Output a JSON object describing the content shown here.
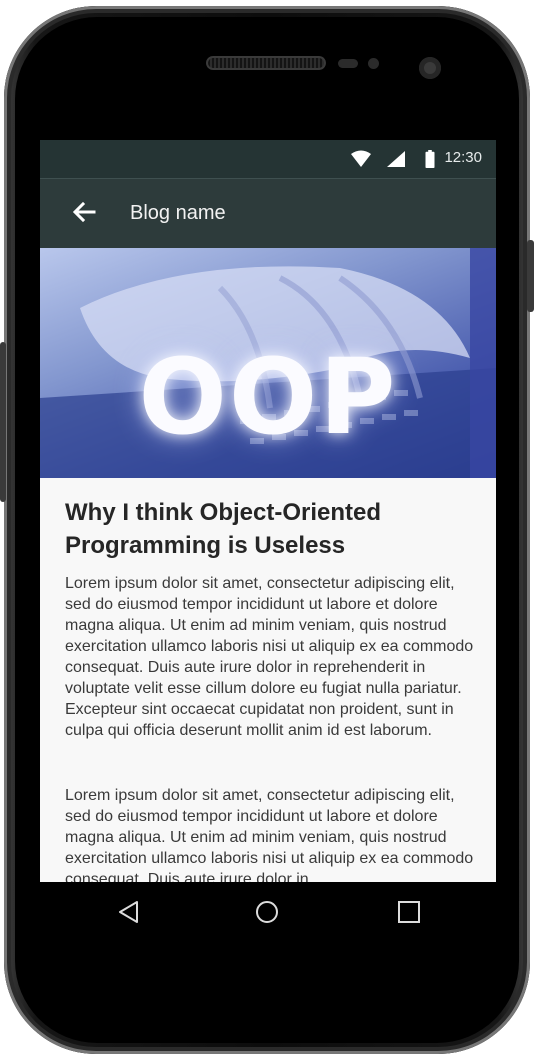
{
  "status_bar": {
    "time": "12:30",
    "icons": [
      "wifi-icon",
      "cell-signal-icon",
      "battery-icon"
    ]
  },
  "app_bar": {
    "back_icon": "arrow-left-icon",
    "title": "Blog name"
  },
  "hero": {
    "text": "OOP"
  },
  "article": {
    "title": "Why I think Object-Oriented Programming is Useless",
    "paragraphs": [
      "Lorem ipsum dolor sit amet, consectetur adipiscing elit, sed do eiusmod tempor incididunt ut labore et dolore magna aliqua. Ut enim ad minim veniam, quis nostrud exercitation ullamco laboris nisi ut aliquip ex ea commodo consequat. Duis aute irure dolor in reprehenderit in voluptate velit esse cillum dolore eu fugiat nulla pariatur. Excepteur sint occaecat cupidatat non proident, sunt in culpa qui officia deserunt mollit anim id est laborum.",
      "Lorem ipsum dolor sit amet, consectetur adipiscing elit, sed do eiusmod tempor incididunt ut labore et dolore magna aliqua. Ut enim ad minim veniam, quis nostrud exercitation ullamco laboris nisi ut aliquip ex ea commodo consequat. Duis aute irure dolor in"
    ]
  },
  "nav_bar": {
    "buttons": [
      "back-triangle-icon",
      "home-circle-icon",
      "recents-square-icon"
    ]
  },
  "colors": {
    "status_bar": "#253434",
    "app_bar": "#2d3b3b",
    "article_background": "#f8f8f8"
  }
}
